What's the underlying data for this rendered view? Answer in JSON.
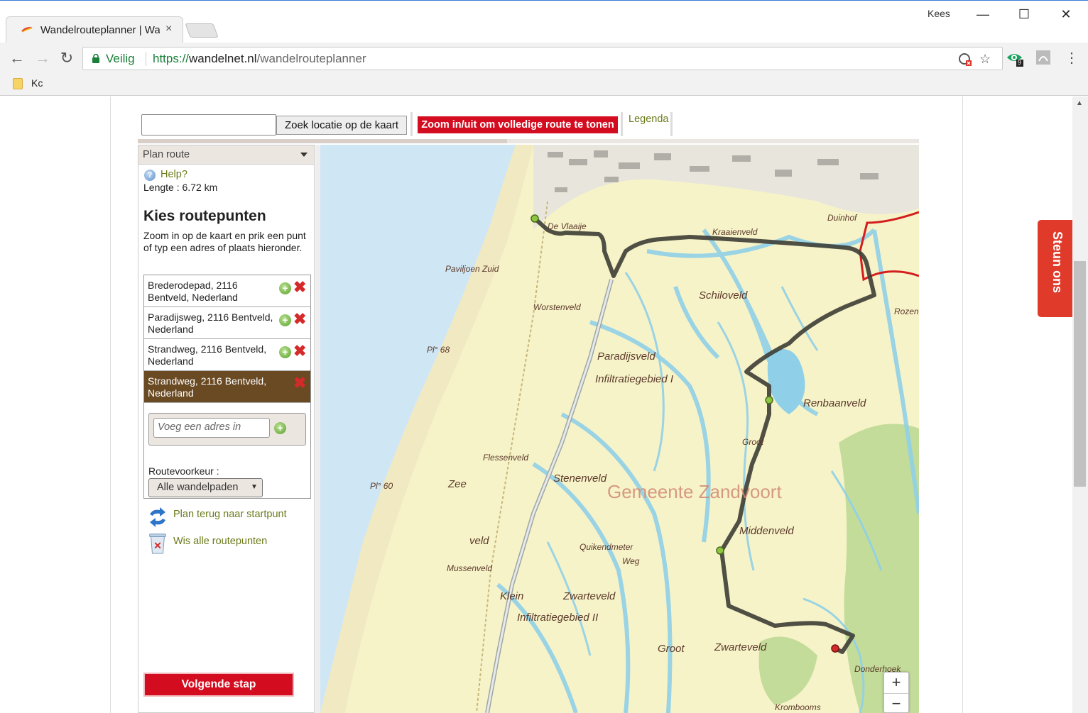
{
  "browser": {
    "tab_title": "Wandelrouteplanner | Wa",
    "tab_close": "×",
    "user": "Kees",
    "minimize": "—",
    "maximize": "☐",
    "close": "✕",
    "back": "←",
    "forward": "→",
    "reload": "↻",
    "secure_label": "Veilig",
    "url_scheme": "https://",
    "url_host": "wandelnet.nl",
    "url_path": "/wandelrouteplanner",
    "bookmark_label": "Kc",
    "extension_badge": "9",
    "menu": "⋮",
    "star": "☆"
  },
  "toolbar": {
    "search_placeholder": "",
    "search_button": "Zoek locatie op de kaart",
    "zoom_notice": "Zoom in/uit om volledige route te tonen",
    "legend_link": "Legenda"
  },
  "panel": {
    "header": "Plan route",
    "help_icon": "?",
    "help": "Help?",
    "length": "Lengte : 6.72 km",
    "heading": "Kies routepunten",
    "intro": "Zoom in op de kaart en prik een punt of typ een adres of plaats hieronder.",
    "waypoints": [
      {
        "text": "Brederodepad, 2116 Bentveld, Nederland",
        "add": "+",
        "remove": "✖"
      },
      {
        "text": "Paradijsweg, 2116 Bentveld, Nederland",
        "add": "+",
        "remove": "✖"
      },
      {
        "text": "Strandweg, 2116 Bentveld, Nederland",
        "add": "+",
        "remove": "✖"
      },
      {
        "text": "Strandweg, 2116 Bentveld, Nederland",
        "add": "",
        "remove": "✖"
      }
    ],
    "add_placeholder": "Voeg een adres in",
    "add_button": "+",
    "preference_label": "Routevoorkeur :",
    "preference_value": "Alle wandelpaden",
    "preference_caret": "▼",
    "plan_back": "Plan terug naar startpunt",
    "clear_all": "Wis alle routepunten",
    "next_step": "Volgende stap"
  },
  "map": {
    "zoom_in": "+",
    "zoom_out": "−",
    "labels": {
      "vlaaije": "De Vlaaije",
      "kraaienveld": "Kraaienveld",
      "duinhof": "Duinhof",
      "paviljoen": "Paviljoen Zuid",
      "schiloveld": "Schiloveld",
      "worstenveld": "Worstenveld",
      "rozen": "Rozen",
      "paradijsveld": "Paradijsveld",
      "infiltratie1": "Infiltratiegebied I",
      "renbaanveld": "Renbaanveld",
      "groot": "Groot",
      "flessenveld": "Flessenveld",
      "zee": "Zee",
      "zandvoort": "Gemeente Zandvoort",
      "stenenveld": "Stenenveld",
      "middenveld": "Middenveld",
      "veld": "veld",
      "mussenveld": "Mussenveld",
      "klein": "Klein",
      "zwarteveld": "Zwarteveld",
      "infiltratie2": "Infiltratiegebied II",
      "groot2": "Groot",
      "zwarteveld2": "Zwarteveld",
      "donderhoek": "Donderhoek",
      "krombooms": "Krombooms",
      "pl68": "Pl° 68",
      "pl60": "Pl° 60",
      "quikendweg": "Quikendmeter",
      "wegl": "Weg"
    }
  },
  "donate": {
    "label": "Steun ons"
  },
  "colors": {
    "accent_red": "#d40c1f",
    "link_green": "#6c7a1a",
    "active_waypoint": "#6a4a23",
    "route": "#3d3d35"
  }
}
